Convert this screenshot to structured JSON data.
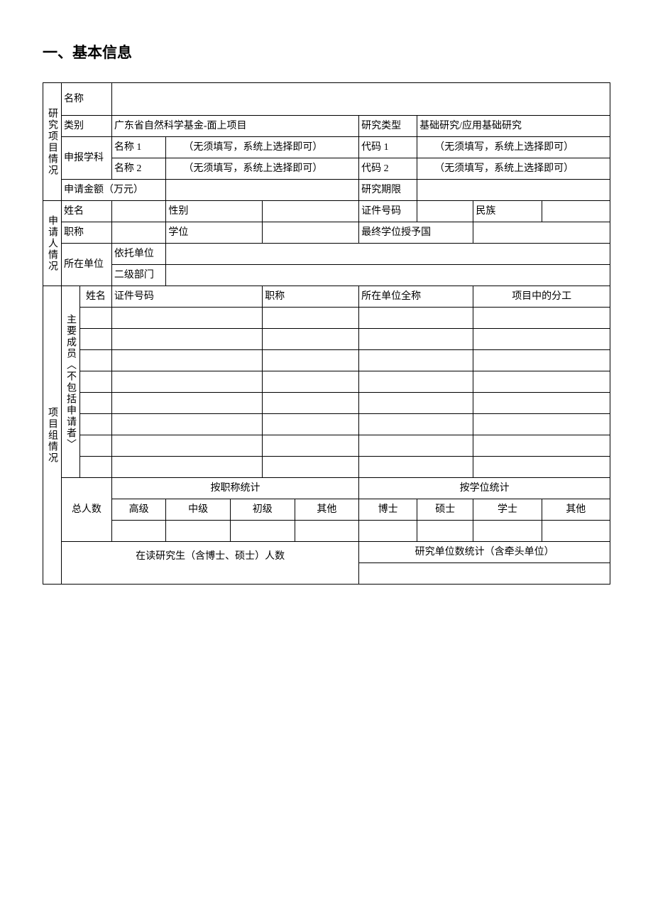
{
  "heading": "一、基本信息",
  "section1": {
    "title": "研究项目情况",
    "name_label": "名称",
    "category_label": "类别",
    "category_value": "广东省自然科学基金-面上项目",
    "research_type_label": "研究类型",
    "research_type_value": "基础研究/应用基础研究",
    "discipline_label": "申报学科",
    "name1_label": "名称 1",
    "name1_value": "　　（无须填写，系统上选择即可）",
    "code1_label": "代码 1",
    "code1_value": "　　（无须填写，系统上选择即可）",
    "name2_label": "名称 2",
    "name2_value": "　　（无须填写，系统上选择即可）",
    "code2_label": "代码 2",
    "code2_value": "　　（无须填写，系统上选择即可）",
    "amount_label": "申请金额（万元）",
    "period_label": "研究期限"
  },
  "section2": {
    "title": "申请人情况",
    "name_label": "姓名",
    "gender_label": "性别",
    "id_label": "证件号码",
    "ethnicity_label": "民族",
    "title_label": "职称",
    "degree_label": "学位",
    "degree_country_label": "最终学位授予国",
    "unit_label": "所在单位",
    "host_unit_label": "依托单位",
    "dept_label": "二级部门"
  },
  "section3": {
    "title": "项目组情况",
    "members_label": "主要成员︿不包括申请者﹀",
    "col_name": "姓名",
    "col_id": "证件号码",
    "col_title": "职称",
    "col_unit": "所在单位全称",
    "col_division": "项目中的分工",
    "total_label": "总人数",
    "by_title_label": "按职称统计",
    "by_degree_label": "按学位统计",
    "senior": "高级",
    "mid": "中级",
    "junior": "初级",
    "other": "其他",
    "doctor": "博士",
    "master": "硕士",
    "bachelor": "学士",
    "other2": "其他",
    "grad_students_label": "在读研究生（含博士、硕士）人数",
    "unit_count_label": "研究单位数统计（含牵头单位）"
  }
}
